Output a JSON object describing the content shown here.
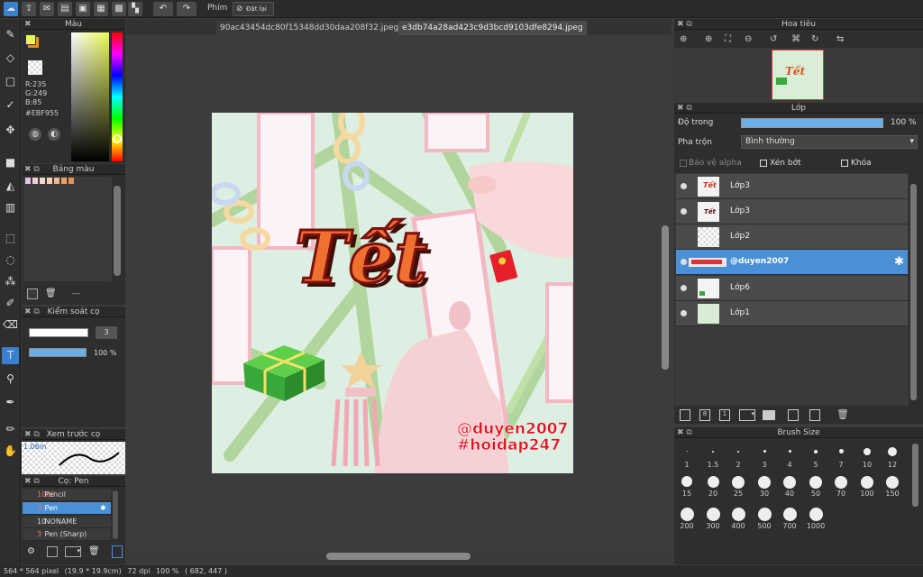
{
  "toolbar": {
    "shortcut_label": "Phím",
    "reset_label": "Đặt lại"
  },
  "tabs": [
    {
      "label": "90ac43454dc80f15348dd30daa208f32.jpeg"
    },
    {
      "label": "e3db74a28ad423c9d3bcd9103dfe8294.jpeg"
    }
  ],
  "color_panel": {
    "title": "Màu",
    "r": "R:235",
    "g": "G:249",
    "b": "B:85",
    "hex": "#EBF955",
    "fg": "#ebf955",
    "bg": "#f08a24"
  },
  "palette_panel": {
    "title": "Bảng màu",
    "empty_label": "---",
    "swatches": [
      "#e8c0f0",
      "#f0d0d8",
      "#f8d8c8",
      "#f8d0b0",
      "#f0b890",
      "#f0a060",
      "#e89050"
    ]
  },
  "brush_ctrl": {
    "title": "Kiểm soát cọ",
    "size": "3",
    "opacity": "100 %"
  },
  "preview": {
    "title": "Xem trước cọ",
    "size": "1.06m"
  },
  "pen_panel": {
    "title": "Cọ: Pen",
    "brushes": [
      {
        "size": "1000",
        "name": "Pencil"
      },
      {
        "size": "3",
        "name": "Pen"
      },
      {
        "size": "10",
        "name": "NONAME"
      },
      {
        "size": "3",
        "name": "Pen (Sharp)"
      }
    ]
  },
  "navigator": {
    "title": "Hoa tiêu"
  },
  "layer_panel": {
    "title": "Lớp",
    "opacity_label": "Độ trong",
    "opacity_value": "100 %",
    "blend_label": "Pha trộn",
    "blend_value": "Bình thường",
    "protect_alpha": "Bảo vệ alpha",
    "clipping": "Xén bớt",
    "lock": "Khóa",
    "layers": [
      {
        "name": "Lớp3"
      },
      {
        "name": "Lớp3"
      },
      {
        "name": "Lớp2"
      },
      {
        "name": "@duyen2007"
      },
      {
        "name": "Lớp6"
      },
      {
        "name": "Lớp1"
      }
    ]
  },
  "brush_size": {
    "title": "Brush Size",
    "sizes": [
      "1",
      "1.5",
      "2",
      "3",
      "4",
      "5",
      "7",
      "10",
      "12",
      "15",
      "20",
      "25",
      "30",
      "40",
      "50",
      "70",
      "100",
      "150",
      "200",
      "300",
      "400",
      "500",
      "700",
      "1000"
    ]
  },
  "artwork": {
    "title": "Tết",
    "watermark1": "@duyen2007",
    "watermark2": "#hoidap247"
  },
  "status": {
    "dims": "564 * 564 pixel",
    "size": "(19.9 * 19.9cm)",
    "dpi": "72 dpi",
    "zoom": "100 %",
    "coords": "( 682, 447 )"
  }
}
